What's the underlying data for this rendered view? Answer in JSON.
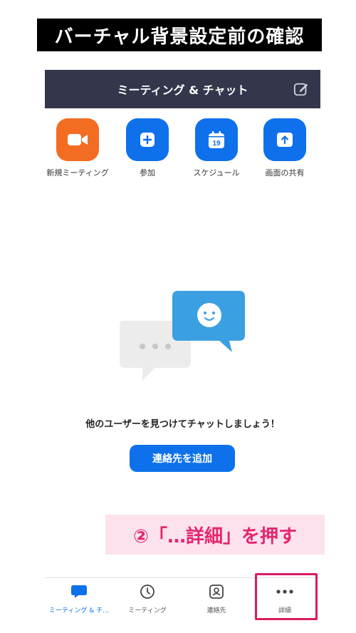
{
  "banner": {
    "title": "バーチャル背景設定前の確認"
  },
  "header": {
    "title": "ミーティング & チャット",
    "compose_icon": "compose-icon"
  },
  "actions": [
    {
      "label": "新規ミーティング",
      "icon": "video-camera-icon",
      "color": "#f26d21"
    },
    {
      "label": "参加",
      "icon": "plus-icon",
      "color": "#0e71eb"
    },
    {
      "label": "スケジュール",
      "icon": "calendar-icon",
      "color": "#0e71eb",
      "calendar_day": "19"
    },
    {
      "label": "画面の共有",
      "icon": "share-screen-icon",
      "color": "#0e71eb"
    }
  ],
  "empty_state": {
    "message": "他のユーザーを見つけてチャットしましょう！",
    "button_label": "連絡先を追加"
  },
  "annotation": {
    "text": "②「…詳細」を押す",
    "color": "#e3266e"
  },
  "tabbar": {
    "tabs": [
      {
        "label": "ミーティング & チ…",
        "icon": "chat-bubble-icon",
        "active": true
      },
      {
        "label": "ミーティング",
        "icon": "clock-icon",
        "active": false
      },
      {
        "label": "連絡先",
        "icon": "contact-icon",
        "active": false
      },
      {
        "label": "詳細",
        "icon": "more-dots-icon",
        "active": false
      }
    ]
  },
  "colors": {
    "accent": "#0e71eb",
    "header_bg": "#34364b",
    "highlight": "#d81b60"
  }
}
